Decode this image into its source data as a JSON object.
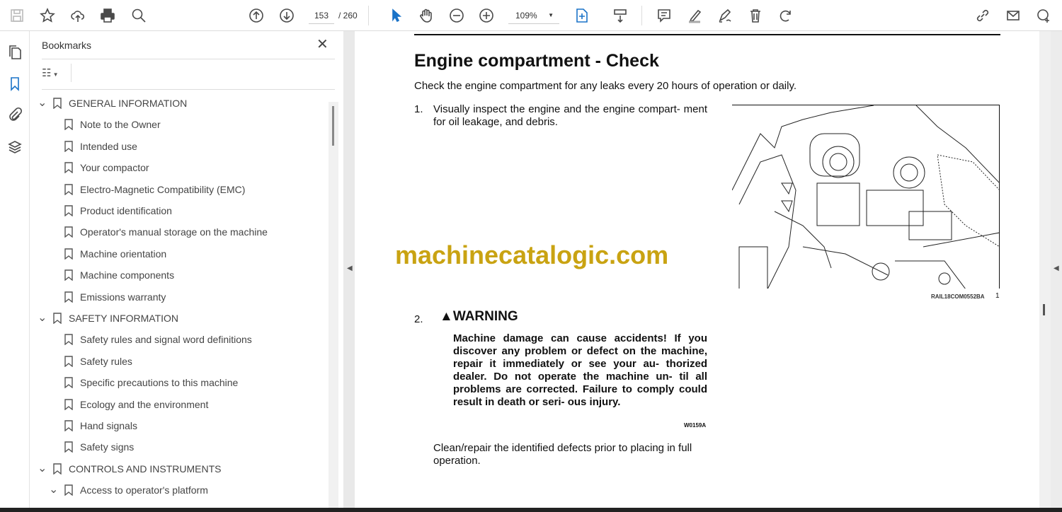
{
  "toolbar": {
    "page_current": "153",
    "page_total": "/ 260",
    "zoom": "109%"
  },
  "sidebar": {
    "title": "Bookmarks",
    "items": [
      {
        "label": "GENERAL INFORMATION",
        "level": 0,
        "expanded": true
      },
      {
        "label": "Note to the Owner",
        "level": 1
      },
      {
        "label": "Intended use",
        "level": 1
      },
      {
        "label": "Your compactor",
        "level": 1
      },
      {
        "label": "Electro-Magnetic Compatibility (EMC)",
        "level": 1
      },
      {
        "label": "Product identification",
        "level": 1
      },
      {
        "label": "Operator's manual storage on the machine",
        "level": 1
      },
      {
        "label": "Machine orientation",
        "level": 1
      },
      {
        "label": "Machine components",
        "level": 1
      },
      {
        "label": "Emissions warranty",
        "level": 1
      },
      {
        "label": "SAFETY INFORMATION",
        "level": 0,
        "expanded": true
      },
      {
        "label": "Safety rules and signal word definitions",
        "level": 1
      },
      {
        "label": "Safety rules",
        "level": 1
      },
      {
        "label": "Specific precautions to this machine",
        "level": 1
      },
      {
        "label": "Ecology and the environment",
        "level": 1
      },
      {
        "label": "Hand signals",
        "level": 1
      },
      {
        "label": "Safety signs",
        "level": 1
      },
      {
        "label": "CONTROLS AND INSTRUMENTS",
        "level": 0,
        "expanded": true
      },
      {
        "label": "Access to operator's platform",
        "level": 1,
        "expanded": true
      }
    ]
  },
  "document": {
    "title": "Engine compartment - Check",
    "intro": "Check the engine compartment for any leaks every 20 hours of operation or daily.",
    "step1_num": "1.",
    "step1": "Visually inspect the engine and the engine compart- ment for oil leakage, and debris.",
    "figure_code": "RAIL18COM0552BA",
    "figure_num": "1",
    "watermark": "machinecatalogic.com",
    "step2_num": "2.",
    "warning_title": "WARNING",
    "warning_text": "Machine damage can cause accidents! If you discover any problem or defect on the machine, repair it immediately or see your au- thorized dealer. Do not operate the machine un- til all problems are corrected. Failure to comply could result in death or seri- ous injury.",
    "warning_code": "W0159A",
    "closing": "Clean/repair the identified defects prior to placing in full operation."
  }
}
